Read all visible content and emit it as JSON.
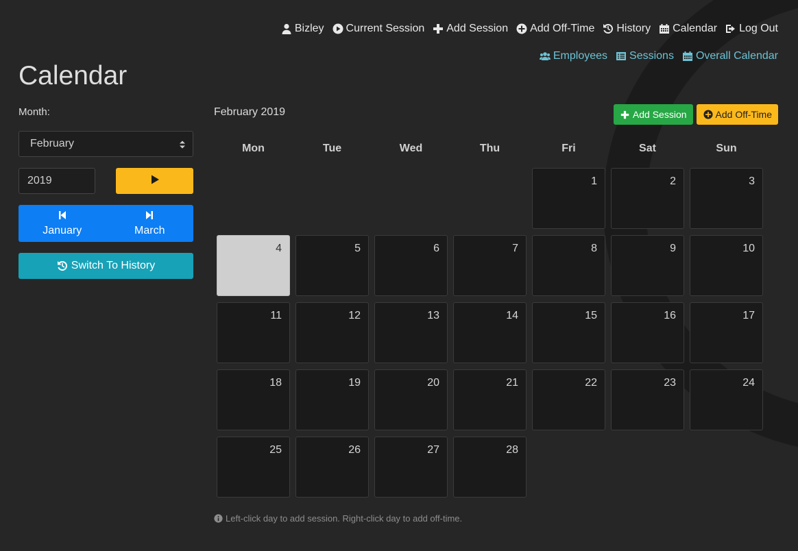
{
  "topnav": {
    "user": "Bizley",
    "current_session": "Current Session",
    "add_session": "Add Session",
    "add_off_time": "Add Off-Time",
    "history": "History",
    "calendar": "Calendar",
    "log_out": "Log Out"
  },
  "subnav": {
    "employees": "Employees",
    "sessions": "Sessions",
    "overall_calendar": "Overall Calendar"
  },
  "page_title": "Calendar",
  "sidebar": {
    "month_label": "Month:",
    "month_value": "February",
    "year_value": "2019",
    "prev_month": "January",
    "next_month": "March",
    "switch_history": "Switch To History"
  },
  "calendar": {
    "title": "February 2019",
    "add_session": "Add Session",
    "add_off_time": "Add Off-Time",
    "weekdays": [
      "Mon",
      "Tue",
      "Wed",
      "Thu",
      "Fri",
      "Sat",
      "Sun"
    ],
    "first_weekday_index": 4,
    "days_in_month": 28,
    "today": 4,
    "hint": "Left-click day to add session. Right-click day to add off-time."
  },
  "colors": {
    "background": "#262626",
    "primary": "#0d7ef4",
    "warning": "#fbb81b",
    "success": "#27a745",
    "info": "#17a2b8",
    "link": "#6cc3d5"
  }
}
